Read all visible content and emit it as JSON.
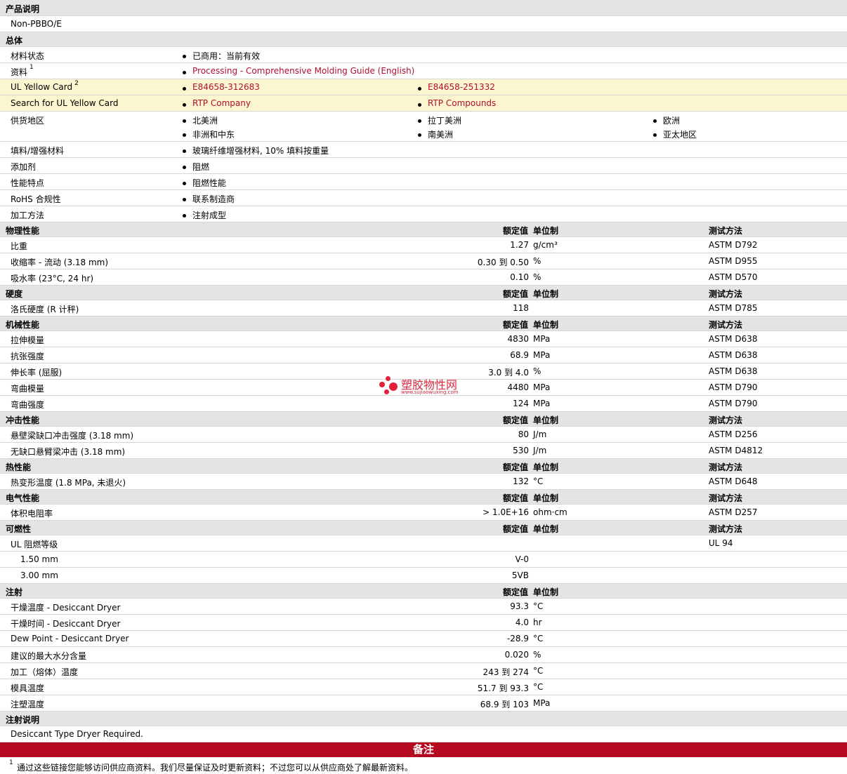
{
  "sections": {
    "product_desc": "产品说明",
    "general": "总体",
    "physical": "物理性能",
    "hardness": "硬度",
    "mechanical": "机械性能",
    "impact": "冲击性能",
    "thermal": "热性能",
    "electrical": "电气性能",
    "flammability": "可燃性",
    "injection": "注射",
    "injection_notes": "注射说明",
    "notes": "备注"
  },
  "header_labels": {
    "nominal": "额定值",
    "unit": "单位制",
    "method": "测试方法"
  },
  "product_desc_text": "Non-PBBO/E",
  "general": {
    "status_label": "材料状态",
    "status_value": "已商用：当前有效",
    "literature_label": "资料",
    "literature_sup": "1",
    "literature_link": "Processing - Comprehensive Molding Guide (English)",
    "ulcard_label": "UL Yellow Card",
    "ulcard_sup": "2",
    "ulcard_links": [
      "E84658-312683",
      "E84658-251332"
    ],
    "search_label": "Search for UL Yellow Card",
    "search_links": [
      "RTP Company",
      "RTP Compounds"
    ],
    "supply_label": "供货地区",
    "supply_regions": [
      "北美洲",
      "拉丁美洲",
      "欧洲",
      "非洲和中东",
      "南美洲",
      "亚太地区"
    ],
    "filler_label": "填料/增强材料",
    "filler_value": "玻璃纤维增强材料, 10% 填料按重量",
    "additive_label": "添加剂",
    "additive_value": "阻燃",
    "features_label": "性能特点",
    "features_value": "阻燃性能",
    "rohs_label": "RoHS 合规性",
    "rohs_value": "联系制造商",
    "process_label": "加工方法",
    "process_value": "注射成型"
  },
  "physical": [
    {
      "label": "比重",
      "value": "1.27",
      "unit": "g/cm³",
      "method": "ASTM D792"
    },
    {
      "label": "收缩率  - 流动  (3.18 mm)",
      "value": "0.30 到  0.50",
      "unit": "%",
      "method": "ASTM D955"
    },
    {
      "label": "吸水率  (23°C, 24 hr)",
      "value": "0.10",
      "unit": "%",
      "method": "ASTM D570"
    }
  ],
  "hardness": [
    {
      "label": "洛氏硬度  (R 计秤)",
      "value": "118",
      "unit": "",
      "method": "ASTM D785"
    }
  ],
  "mechanical": [
    {
      "label": "拉伸模量",
      "value": "4830",
      "unit": "MPa",
      "method": "ASTM D638"
    },
    {
      "label": "抗张强度",
      "value": "68.9",
      "unit": "MPa",
      "method": "ASTM D638"
    },
    {
      "label": "伸长率  (屈服)",
      "value": "3.0 到  4.0",
      "unit": "%",
      "method": "ASTM D638"
    },
    {
      "label": "弯曲模量",
      "value": "4480",
      "unit": "MPa",
      "method": "ASTM D790"
    },
    {
      "label": "弯曲强度",
      "value": "124",
      "unit": "MPa",
      "method": "ASTM D790"
    }
  ],
  "impact": [
    {
      "label": "悬壁梁缺口冲击强度  (3.18 mm)",
      "value": "80",
      "unit": "J/m",
      "method": "ASTM D256"
    },
    {
      "label": "无缺口悬臂梁冲击  (3.18 mm)",
      "value": "530",
      "unit": "J/m",
      "method": "ASTM D4812"
    }
  ],
  "thermal": [
    {
      "label": "热变形温度  (1.8 MPa, 未退火)",
      "value": "132",
      "unit": "°C",
      "method": "ASTM D648"
    }
  ],
  "electrical": [
    {
      "label": "体积电阻率",
      "value": "> 1.0E+16",
      "unit": "ohm·cm",
      "method": "ASTM D257"
    }
  ],
  "flammability": {
    "rating_label": "UL 阻燃等级",
    "rating_method": "UL 94",
    "rows": [
      {
        "label": "1.50 mm",
        "value": "V-0"
      },
      {
        "label": "3.00 mm",
        "value": "5VB"
      }
    ]
  },
  "injection": [
    {
      "label": "干燥温度  - Desiccant Dryer",
      "value": "93.3",
      "unit": "°C"
    },
    {
      "label": "干燥时间  - Desiccant Dryer",
      "value": "4.0",
      "unit": "hr"
    },
    {
      "label": "Dew Point - Desiccant Dryer",
      "value": "-28.9",
      "unit": "°C"
    },
    {
      "label": "建议的最大水分含量",
      "value": "0.020",
      "unit": "%"
    },
    {
      "label": "加工（熔体）温度",
      "value": "243 到  274",
      "unit": "°C"
    },
    {
      "label": "模具温度",
      "value": "51.7 到  93.3",
      "unit": "°C"
    },
    {
      "label": "注塑温度",
      "value": "68.9 到  103",
      "unit": "MPa"
    }
  ],
  "injection_notes_text": "Desiccant Type Dryer Required.",
  "footnote": {
    "sup": "1",
    "text": "通过这些链接您能够访问供应商资料。我们尽量保证及时更新资料；不过您可以从供应商处了解最新资料。"
  },
  "watermark": {
    "name": "塑胶物性网",
    "url": "www.sujiaowuxing.com"
  },
  "colors": {
    "section_bg": "#e4e4e4",
    "highlight_bg": "#fbf6cf",
    "link": "#b0102c",
    "banner": "#b4091f"
  }
}
